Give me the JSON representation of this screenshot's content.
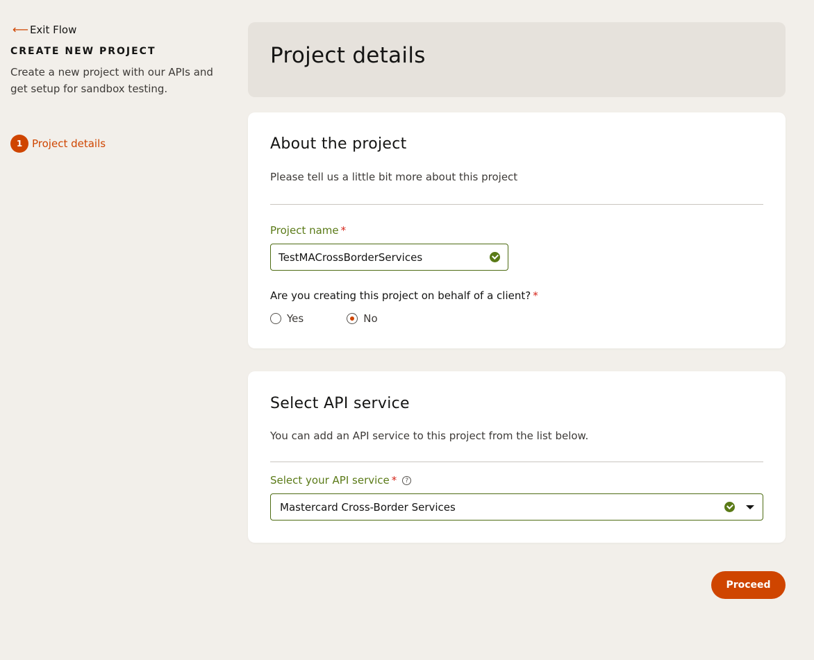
{
  "sidebar": {
    "exit_label": "Exit Flow",
    "title": "CREATE NEW PROJECT",
    "description": "Create a new project with our APIs and get setup for sandbox testing.",
    "steps": [
      {
        "number": "1",
        "label": "Project details",
        "active": true
      }
    ]
  },
  "header": {
    "title": "Project details"
  },
  "about": {
    "title": "About the project",
    "description": "Please tell us a little bit more about this project",
    "project_name_label": "Project name",
    "required_mark": "*",
    "project_name_value": "TestMACrossBorderServices",
    "client_question": "Are you creating this project on behalf of a client?",
    "options": [
      {
        "label": "Yes",
        "selected": false
      },
      {
        "label": "No",
        "selected": true
      }
    ]
  },
  "api": {
    "title": "Select API service",
    "description": "You can add an API service to this project from the list below.",
    "select_label": "Select your API service",
    "required_mark": "*",
    "help_symbol": "?",
    "selected_service": "Mastercard Cross-Border Services"
  },
  "actions": {
    "proceed_label": "Proceed"
  },
  "colors": {
    "accent": "#cf4500",
    "success": "#5a7a17",
    "background": "#f2efea"
  }
}
